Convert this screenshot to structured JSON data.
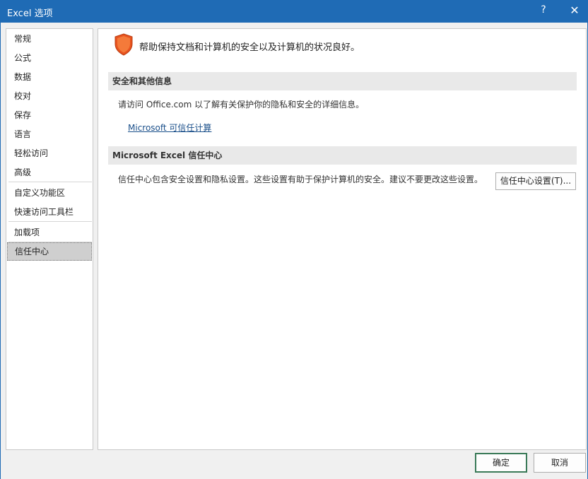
{
  "window": {
    "title": "Excel 选项",
    "help_label": "?",
    "close_label": "✕"
  },
  "sidebar": {
    "items": [
      {
        "label": "常规"
      },
      {
        "label": "公式"
      },
      {
        "label": "数据"
      },
      {
        "label": "校对"
      },
      {
        "label": "保存"
      },
      {
        "label": "语言"
      },
      {
        "label": "轻松访问"
      },
      {
        "label": "高级"
      },
      {
        "label": "自定义功能区"
      },
      {
        "label": "快速访问工具栏"
      },
      {
        "label": "加载项"
      },
      {
        "label": "信任中心"
      }
    ],
    "selected": "信任中心"
  },
  "main": {
    "shield_icon": "shield-icon",
    "intro": "帮助保持文档和计算机的安全以及计算机的状况良好。",
    "privacy": {
      "header": "安全和其他信息",
      "text": "请访问 Office.com 以了解有关保护你的隐私和安全的详细信息。",
      "link": "Microsoft 可信任计算"
    },
    "trust_center": {
      "header": "Microsoft Excel 信任中心",
      "text": "信任中心包含安全设置和隐私设置。这些设置有助于保护计算机的安全。建议不要更改这些设置。",
      "button": "信任中心设置(T)..."
    }
  },
  "footer": {
    "ok": "确定",
    "cancel": "取消"
  },
  "colors": {
    "titlebar": "#1f6bb5",
    "shield": "#e8531f",
    "link": "#1a4f8a",
    "ok_border": "#3a7a58"
  }
}
